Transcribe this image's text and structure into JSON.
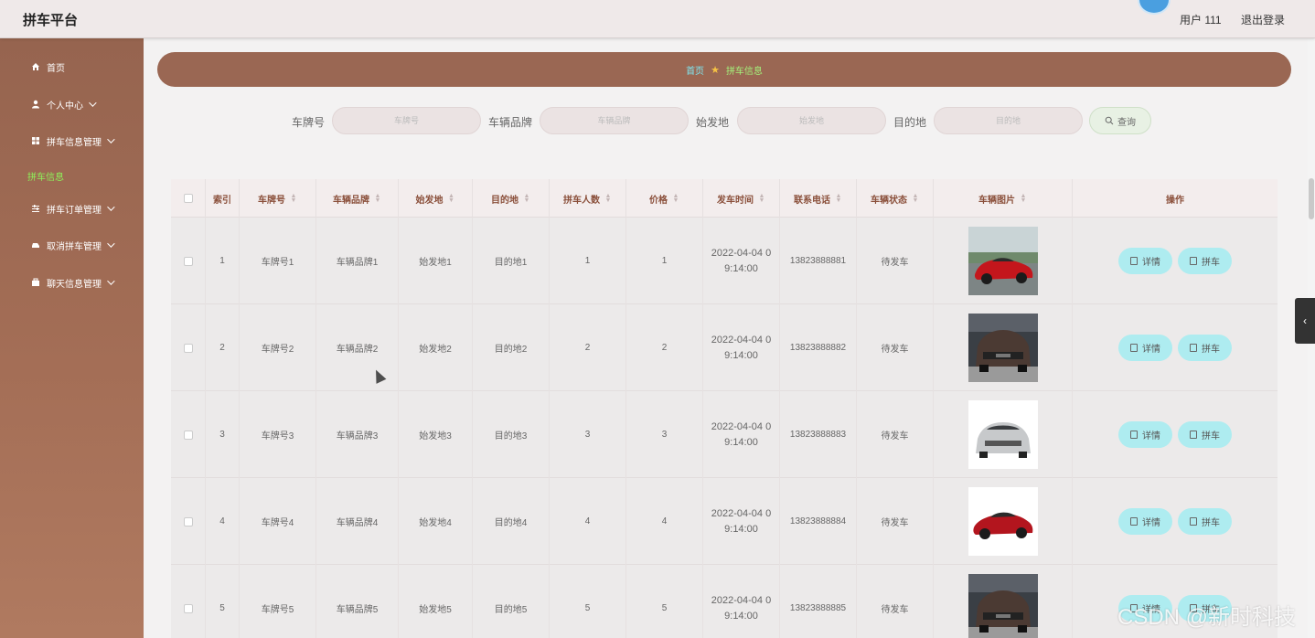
{
  "header": {
    "brand": "拼车平台",
    "user": "用户 111",
    "logout": "退出登录"
  },
  "sidebar": {
    "items": [
      {
        "label": "首页",
        "icon": "home-icon"
      },
      {
        "label": "个人中心",
        "icon": "user-icon"
      },
      {
        "label": "拼车信息管理",
        "icon": "grid-icon"
      },
      {
        "label": "拼车订单管理",
        "icon": "sliders-icon"
      },
      {
        "label": "取消拼车管理",
        "icon": "car-icon"
      },
      {
        "label": "聊天信息管理",
        "icon": "chat-icon"
      }
    ],
    "active_sub": "拼车信息"
  },
  "breadcrumb": {
    "home": "首页",
    "current": "拼车信息"
  },
  "search": {
    "plate_label": "车牌号",
    "plate_placeholder": "车牌号",
    "brand_label": "车辆品牌",
    "brand_placeholder": "车辆品牌",
    "origin_label": "始发地",
    "origin_placeholder": "始发地",
    "dest_label": "目的地",
    "dest_placeholder": "目的地",
    "query_button": "查询"
  },
  "table": {
    "columns": [
      "索引",
      "车牌号",
      "车辆品牌",
      "始发地",
      "目的地",
      "拼车人数",
      "价格",
      "发车时间",
      "联系电话",
      "车辆状态",
      "车辆图片",
      "操作"
    ],
    "rows": [
      {
        "index": "1",
        "plate": "车牌号1",
        "brand": "车辆品牌1",
        "origin": "始发地1",
        "dest": "目的地1",
        "seats": "1",
        "price": "1",
        "time_a": "2022-04-04 0",
        "time_b": "9:14:00",
        "phone": "13823888881",
        "status": "待发车",
        "image": "red-sports-car"
      },
      {
        "index": "2",
        "plate": "车牌号2",
        "brand": "车辆品牌2",
        "origin": "始发地2",
        "dest": "目的地2",
        "seats": "2",
        "price": "2",
        "time_a": "2022-04-04 0",
        "time_b": "9:14:00",
        "phone": "13823888882",
        "status": "待发车",
        "image": "dark-suv"
      },
      {
        "index": "3",
        "plate": "车牌号3",
        "brand": "车辆品牌3",
        "origin": "始发地3",
        "dest": "目的地3",
        "seats": "3",
        "price": "3",
        "time_a": "2022-04-04 0",
        "time_b": "9:14:00",
        "phone": "13823888883",
        "status": "待发车",
        "image": "silver-suv"
      },
      {
        "index": "4",
        "plate": "车牌号4",
        "brand": "车辆品牌4",
        "origin": "始发地4",
        "dest": "目的地4",
        "seats": "4",
        "price": "4",
        "time_a": "2022-04-04 0",
        "time_b": "9:14:00",
        "phone": "13823888884",
        "status": "待发车",
        "image": "red-sedan"
      },
      {
        "index": "5",
        "plate": "车牌号5",
        "brand": "车辆品牌5",
        "origin": "始发地5",
        "dest": "目的地5",
        "seats": "5",
        "price": "5",
        "time_a": "2022-04-04 0",
        "time_b": "9:14:00",
        "phone": "13823888885",
        "status": "待发车",
        "image": "dark-suv"
      }
    ],
    "detail_button": "详情",
    "carpool_button": "拼车"
  },
  "watermark": "CSDN @新时科技",
  "colors": {
    "sidebar": "#a46e56",
    "breadcrumb_bar": "#9a6753",
    "action_button": "#aeecf0",
    "header_text": "#8a4f3a",
    "active_nav": "#8ef05a"
  }
}
